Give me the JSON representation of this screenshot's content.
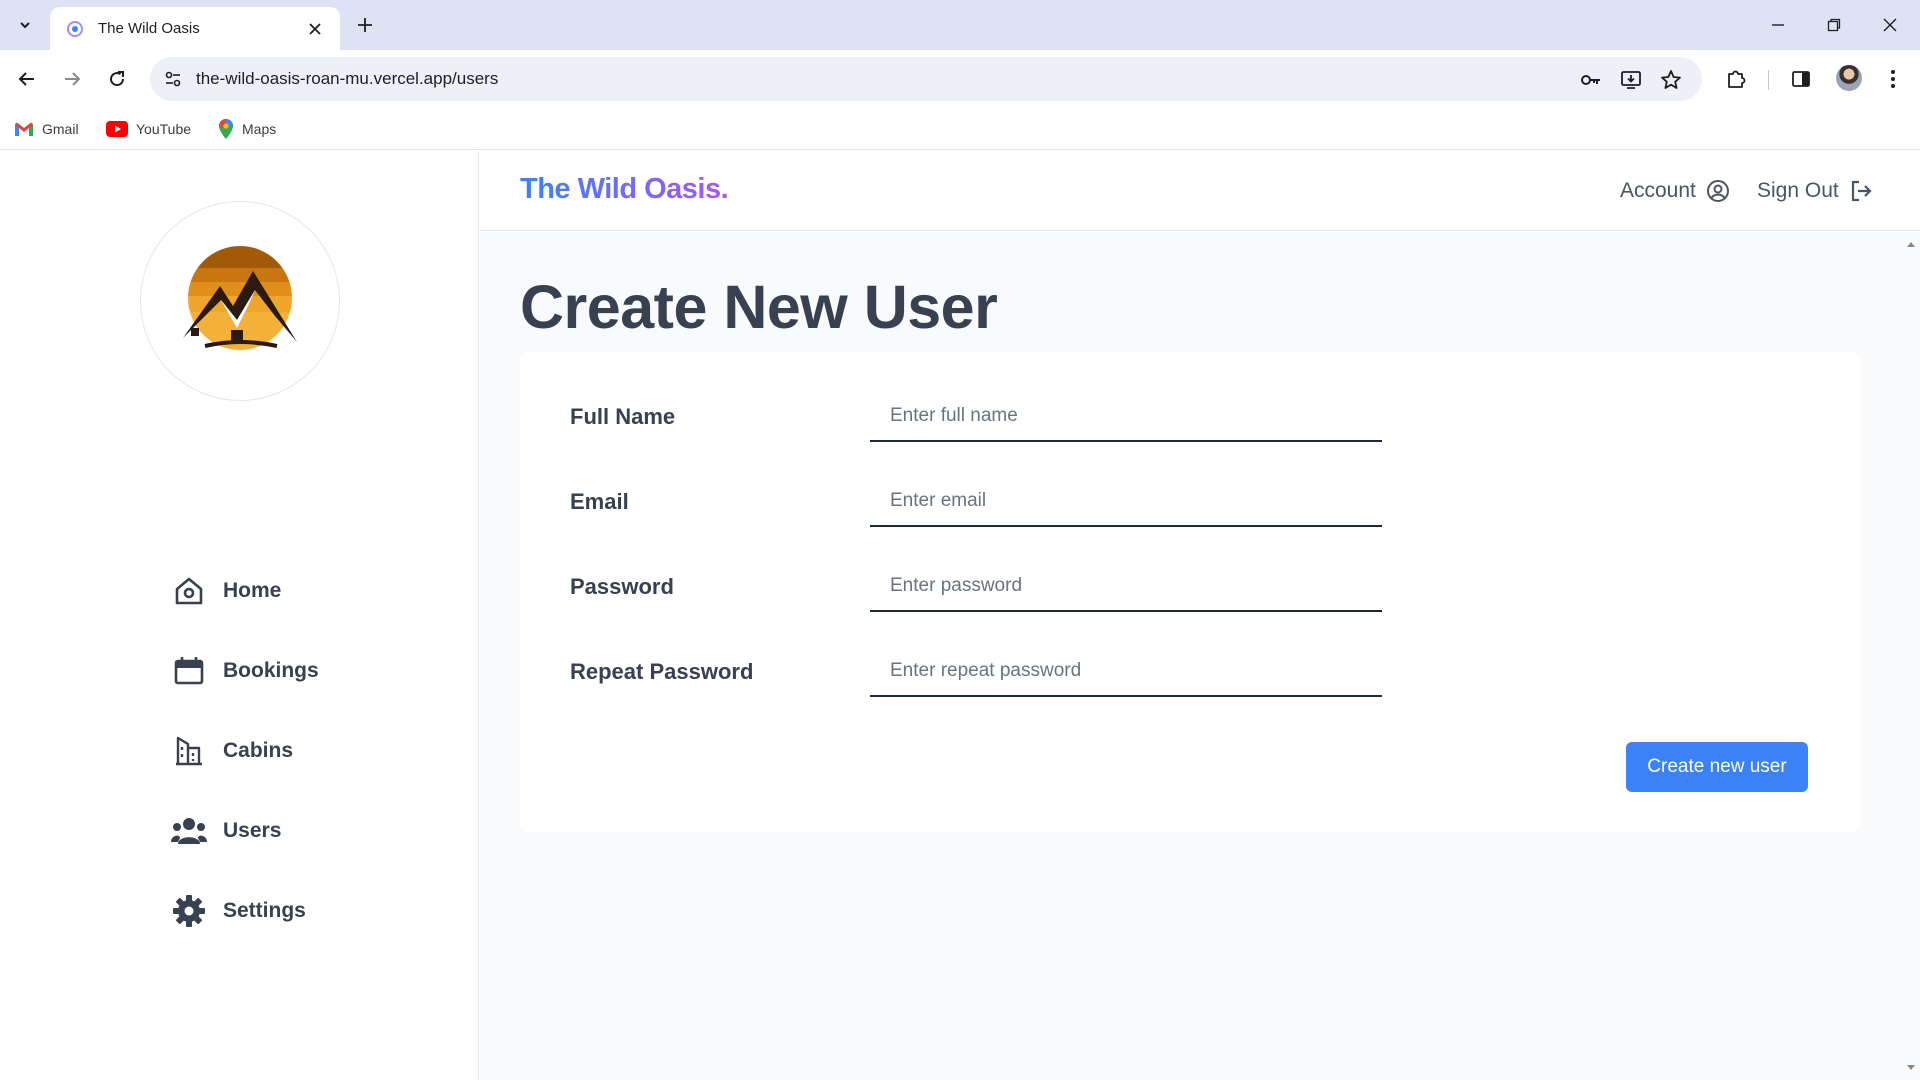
{
  "browser": {
    "tab_title": "The Wild Oasis",
    "url": "the-wild-oasis-roan-mu.vercel.app/users",
    "bookmarks": [
      {
        "label": "Gmail"
      },
      {
        "label": "YouTube"
      },
      {
        "label": "Maps"
      }
    ]
  },
  "header": {
    "brand": "The Wild Oasis.",
    "account_label": "Account",
    "signout_label": "Sign Out"
  },
  "sidebar": {
    "items": [
      {
        "label": "Home",
        "icon": "home-icon"
      },
      {
        "label": "Bookings",
        "icon": "calendar-icon"
      },
      {
        "label": "Cabins",
        "icon": "building-icon"
      },
      {
        "label": "Users",
        "icon": "users-icon"
      },
      {
        "label": "Settings",
        "icon": "gear-icon"
      }
    ]
  },
  "main": {
    "title": "Create New User",
    "form": {
      "fields": [
        {
          "label": "Full Name",
          "placeholder": "Enter full name",
          "value": ""
        },
        {
          "label": "Email",
          "placeholder": "Enter email",
          "value": ""
        },
        {
          "label": "Password",
          "placeholder": "Enter password",
          "value": ""
        },
        {
          "label": "Repeat Password",
          "placeholder": "Enter repeat password",
          "value": ""
        }
      ],
      "submit_label": "Create new user"
    }
  },
  "colors": {
    "accent": "#3b82f6",
    "brand_gradient_start": "#3b82f6",
    "brand_gradient_end": "#a855f7",
    "text": "#374151"
  }
}
